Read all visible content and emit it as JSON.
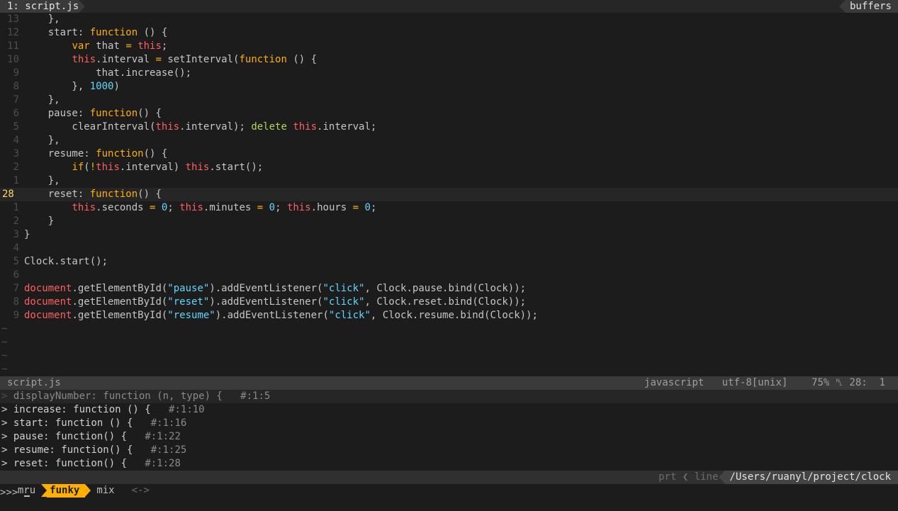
{
  "tabline": {
    "active_tab": "1: script.js",
    "buffers_label": "buffers"
  },
  "editor": {
    "lines": [
      {
        "num": "13",
        "html": "    },"
      },
      {
        "num": "12",
        "html": "    start: <span class='kw'>function</span> () {"
      },
      {
        "num": "11",
        "html": "        <span class='kw'>var</span> that <span class='op'>=</span> <span class='this'>this</span>;"
      },
      {
        "num": "10",
        "html": "        <span class='this'>this</span>.interval <span class='op'>=</span> setInterval(<span class='kw'>function</span> () {"
      },
      {
        "num": "9",
        "html": "            that.increase();"
      },
      {
        "num": "8",
        "html": "        }, <span class='num'>1000</span>)"
      },
      {
        "num": "7",
        "html": "    },"
      },
      {
        "num": "6",
        "html": "    pause: <span class='kw'>function</span>() {"
      },
      {
        "num": "5",
        "html": "        clearInterval(<span class='this'>this</span>.interval); <span class='del'>delete</span> <span class='this'>this</span>.interval;"
      },
      {
        "num": "4",
        "html": "    },"
      },
      {
        "num": "3",
        "html": "    resume: <span class='kw'>function</span>() {"
      },
      {
        "num": "2",
        "html": "        <span class='kw'>if</span>(<span class='op'>!</span><span class='this'>this</span>.interval) <span class='this'>this</span>.start();"
      },
      {
        "num": "1",
        "html": "    },"
      },
      {
        "num": "28",
        "html": "    reset: <span class='kw'>function</span>() {",
        "current": true
      },
      {
        "num": "1",
        "html": "        <span class='this'>this</span>.seconds <span class='op'>=</span> <span class='num'>0</span>; <span class='this'>this</span>.minutes <span class='op'>=</span> <span class='num'>0</span>; <span class='this'>this</span>.hours <span class='op'>=</span> <span class='num'>0</span>;"
      },
      {
        "num": "2",
        "html": "    }"
      },
      {
        "num": "3",
        "html": "}"
      },
      {
        "num": "4",
        "html": ""
      },
      {
        "num": "5",
        "html": "Clock.start();"
      },
      {
        "num": "6",
        "html": ""
      },
      {
        "num": "7",
        "html": "<span class='doc'>document</span>.getElementById(<span class='str'>\"pause\"</span>).addEventListener(<span class='str'>\"click\"</span>, Clock.pause.bind(Clock));"
      },
      {
        "num": "8",
        "html": "<span class='doc'>document</span>.getElementById(<span class='str'>\"reset\"</span>).addEventListener(<span class='str'>\"click\"</span>, Clock.reset.bind(Clock));"
      },
      {
        "num": "9",
        "html": "<span class='doc'>document</span>.getElementById(<span class='str'>\"resume\"</span>).addEventListener(<span class='str'>\"click\"</span>, Clock.resume.bind(Clock));"
      }
    ],
    "tilde_count": 4,
    "tilde": "~"
  },
  "statusline": {
    "filename": "script.js",
    "filetype": "javascript",
    "encoding": "utf-8[unix]",
    "percent": "75%",
    "position": "28:  1"
  },
  "funky": {
    "items": [
      {
        "text": "displayNumber: function (n, type) {",
        "loc": "#:1:5",
        "selected": true
      },
      {
        "text": "increase: function () {",
        "loc": "#:1:10"
      },
      {
        "text": "start: function () {",
        "loc": "#:1:16"
      },
      {
        "text": "pause: function() {",
        "loc": "#:1:22"
      },
      {
        "text": "resume: function() {",
        "loc": "#:1:25"
      },
      {
        "text": "reset: function() {",
        "loc": "#:1:28"
      }
    ]
  },
  "ctrlp": {
    "mode_prev": "mru",
    "mode_active": "funky",
    "mode_next": "mix",
    "nav": "<->",
    "prt": "prt",
    "line": "line",
    "path": "/Users/ruanyl/project/clock"
  },
  "prompt": {
    "text": ">>> "
  },
  "colors": {
    "background": "#1c1c1c",
    "keyword": "#ffaf00",
    "this": "#ff5f5f",
    "number": "#5fd7ff",
    "current_line_number": "#ffd75f",
    "active_mode": "#ffaf00"
  }
}
